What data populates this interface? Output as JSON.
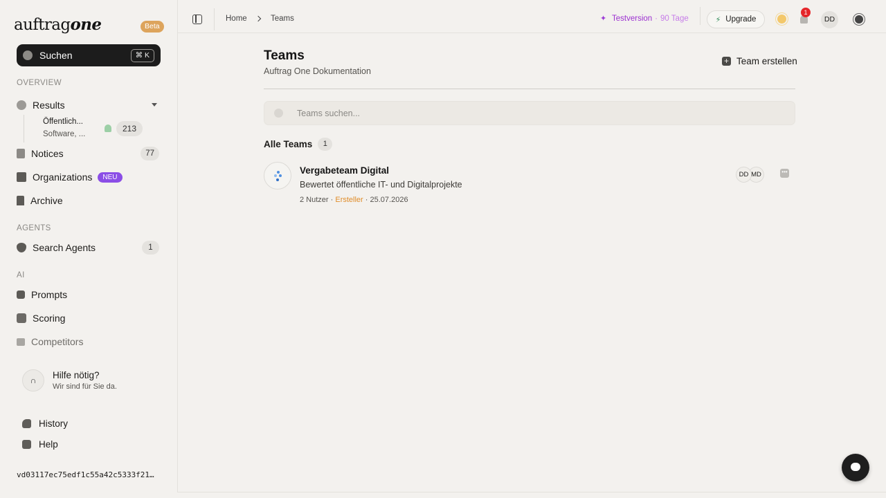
{
  "sidebar": {
    "logo": {
      "part1": "auftrag",
      "part2": "one"
    },
    "beta_badge": "Beta",
    "search": {
      "label": "Suchen",
      "shortcut": "⌘ K"
    },
    "sections": {
      "overview": "OVERVIEW",
      "agents": "AGENTS",
      "ai": "AI"
    },
    "items": {
      "results": {
        "label": "Results"
      },
      "results_sub": {
        "line1": "Öffentlich...",
        "line2": "Software, ...",
        "count": "213"
      },
      "notices": {
        "label": "Notices",
        "count": "77"
      },
      "organizations": {
        "label": "Organizations",
        "badge": "NEU"
      },
      "archive": {
        "label": "Archive"
      },
      "search_agents": {
        "label": "Search Agents",
        "count": "1"
      },
      "prompts": {
        "label": "Prompts"
      },
      "scoring": {
        "label": "Scoring"
      },
      "competitors": {
        "label": "Competitors"
      }
    },
    "help": {
      "title": "Hilfe nötig?",
      "subtitle": "Wir sind für Sie da."
    },
    "footer": {
      "history": "History",
      "help": "Help"
    },
    "hash": "vd03117ec75edf1c55a42c5333f21…"
  },
  "topbar": {
    "breadcrumb": [
      "Home",
      "Teams"
    ],
    "trial": {
      "label": "Testversion",
      "separator": "·",
      "days": "90 Tage"
    },
    "upgrade": "Upgrade",
    "notifications": "1",
    "user_initials": "DD"
  },
  "main": {
    "title": "Teams",
    "subtitle": "Auftrag One Dokumentation",
    "create_button": "Team erstellen",
    "search_placeholder": "Teams suchen...",
    "all_teams": {
      "label": "Alle Teams",
      "count": "1"
    },
    "teams": [
      {
        "name": "Vergabeteam Digital",
        "description": "Bewertet öffentliche IT- und Digitalprojekte",
        "members": "2 Nutzer",
        "role": "Ersteller",
        "date": "25.07.2026",
        "avatars": [
          "DD",
          "MD"
        ]
      }
    ]
  },
  "colors": {
    "accent_purple": "#9b2fd0",
    "beta_orange": "#dda45c",
    "neu_purple": "#8b4ee6",
    "role_orange": "#e08d2a",
    "notification_red": "#e5262a"
  },
  "icons": {
    "search": "search-icon",
    "results": "circle-icon",
    "notices": "document-icon",
    "organizations": "buildings-icon",
    "archive": "bookmark-icon",
    "search_agents": "shield-icon",
    "prompts": "chip-icon",
    "scoring": "gauge-icon",
    "competitors": "chart-icon",
    "help": "headphones-icon",
    "history": "clock-icon",
    "help_footer": "chat-icon",
    "theme": "sun-icon",
    "notifications": "bell-icon",
    "settings": "gear-icon",
    "sidebar_toggle": "sidebar-toggle-icon",
    "create": "plus-icon",
    "more": "more-icon",
    "chat": "chat-bubble-icon"
  }
}
